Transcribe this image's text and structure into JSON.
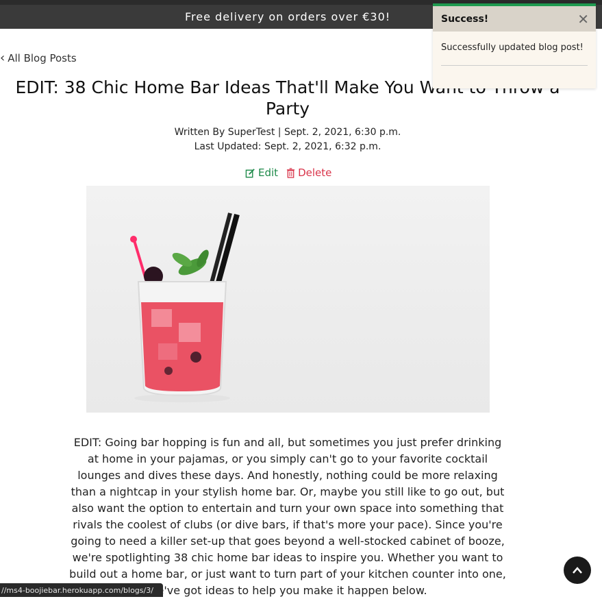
{
  "banner": {
    "text": "Free delivery on orders over €30!"
  },
  "nav": {
    "back_label": "All Blog Posts"
  },
  "post": {
    "title": "EDIT: 38 Chic Home Bar Ideas That'll Make You Want to Throw a Party",
    "written_by": "Written By SuperTest | Sept. 2, 2021, 6:30 p.m.",
    "last_updated": "Last Updated: Sept. 2, 2021, 6:32 p.m.",
    "edit_label": "Edit",
    "delete_label": "Delete",
    "body": "EDIT: Going bar hopping is fun and all, but sometimes you just prefer drinking at home in your pajamas, or you simply can't go to your favorite cocktail lounges and dives these days. And honestly, nothing could be more relaxing than a nightcap in your stylish home bar. Or, maybe you still like to go out, but also want the option to entertain and turn your own space into something that rivals the coolest of clubs (or dive bars, if that's more your pace). Since you're going to need a killer set-up that goes beyond a well-stocked cabinet of booze, we're spotlighting 38 chic home bar ideas to inspire you. Whether you want to build out a home bar, or just want to turn part of your kitchen counter into one, we've got ideas to help you make it happen below."
  },
  "toast": {
    "title": "Success!",
    "message": "Successfully updated blog post!"
  },
  "status_bar": {
    "url": "//ms4-boojiebar.herokuapp.com/blogs/3/"
  },
  "colors": {
    "edit": "#1e8a4a",
    "delete": "#d9344a",
    "toast_accent": "#1f9a4f"
  }
}
